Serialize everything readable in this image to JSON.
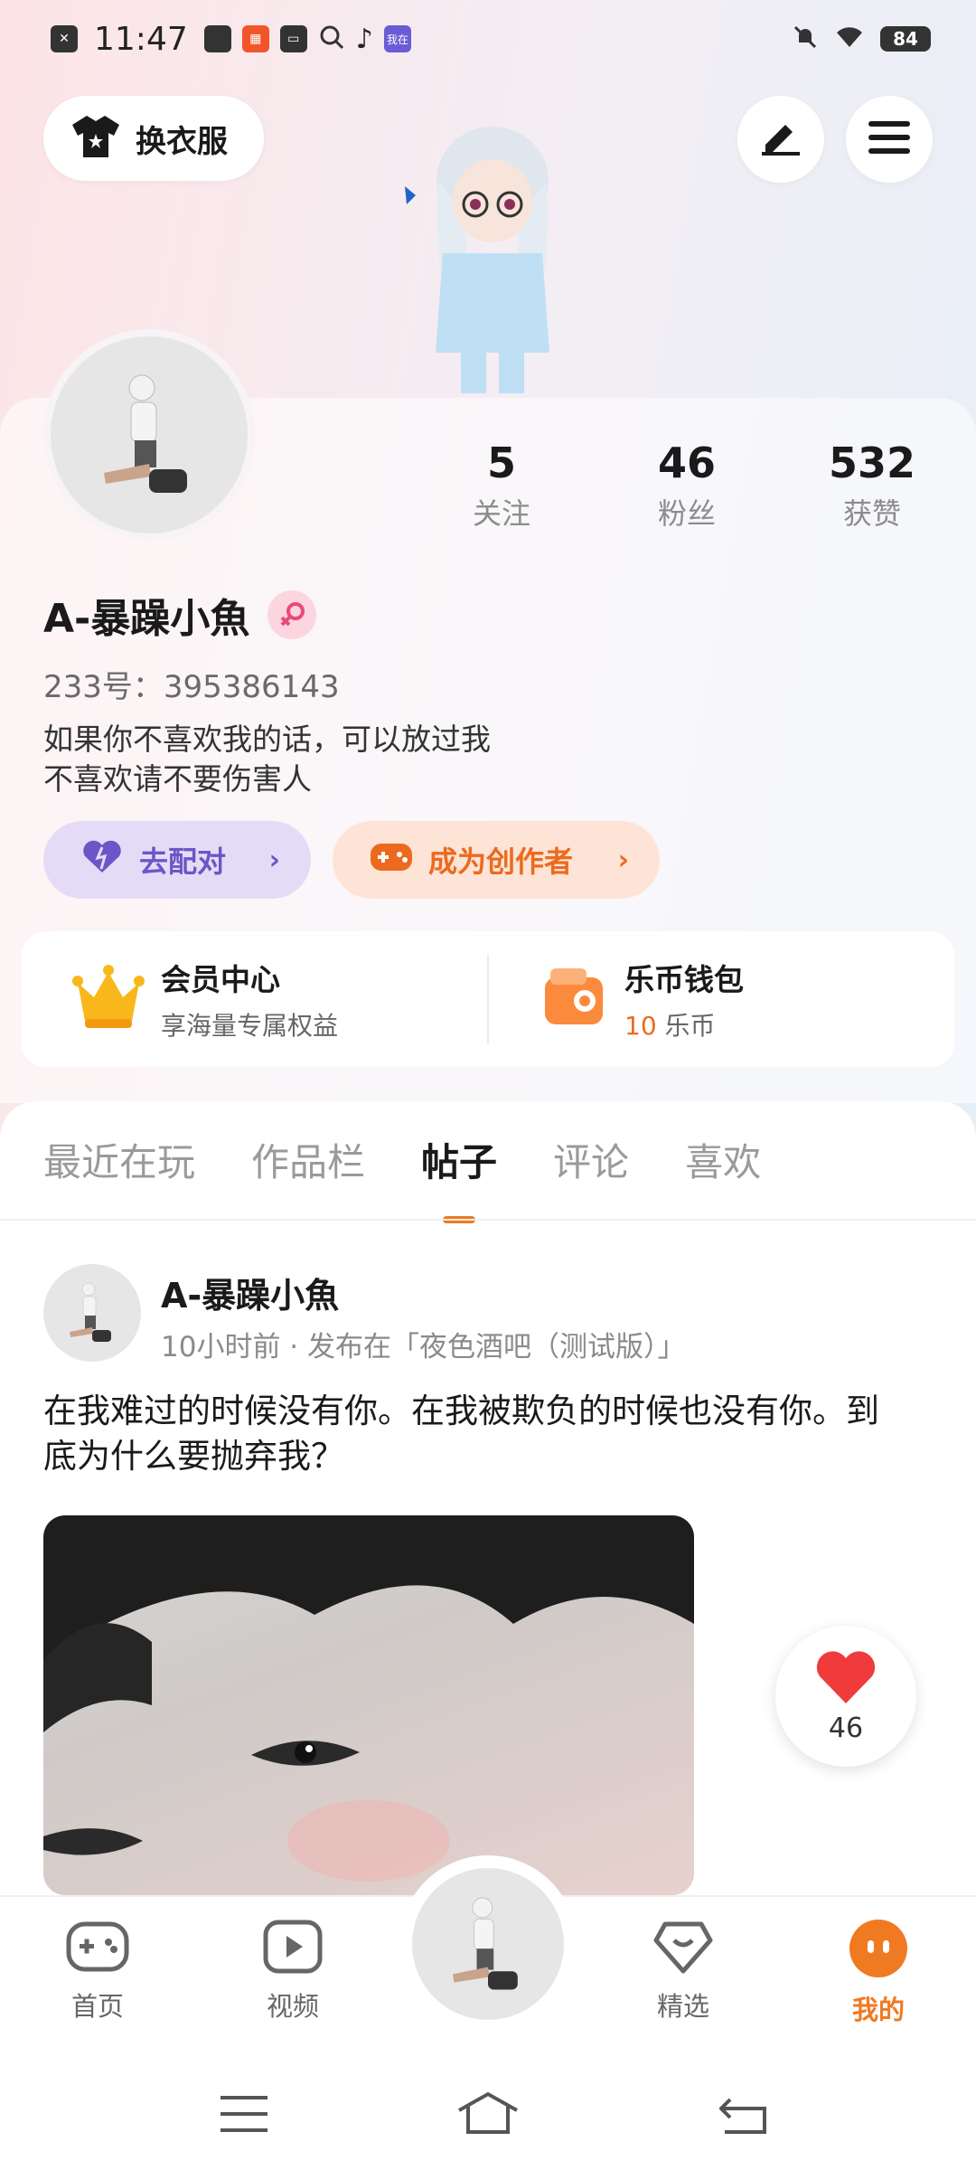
{
  "status_bar": {
    "time": "11:47",
    "battery": "84",
    "app_icon_label": "我在"
  },
  "header": {
    "outfit_label": "换衣服"
  },
  "profile": {
    "stats": [
      {
        "num": "5",
        "label": "关注"
      },
      {
        "num": "46",
        "label": "粉丝"
      },
      {
        "num": "532",
        "label": "获赞"
      }
    ],
    "username": "A-暴躁小魚",
    "user_id": "233号：395386143",
    "bio_line1": "如果你不喜欢我的话，可以放过我",
    "bio_line2": "不喜欢请不要伤害人",
    "match_label": "去配对",
    "creator_label": "成为创作者"
  },
  "member_card": {
    "vip_title": "会员中心",
    "vip_sub": "享海量专属权益",
    "wallet_title": "乐币钱包",
    "coin_count": "10",
    "coin_unit": "乐币"
  },
  "tabs": [
    {
      "label": "最近在玩"
    },
    {
      "label": "作品栏"
    },
    {
      "label": "帖子"
    },
    {
      "label": "评论"
    },
    {
      "label": "喜欢"
    }
  ],
  "active_tab": "帖子",
  "post": {
    "author": "A-暴躁小魚",
    "meta": "10小时前 · 发布在「夜色酒吧（测试版）」",
    "text": "在我难过的时候没有你。在我被欺负的时候也没有你。到底为什么要抛弃我？",
    "like_count": "46"
  },
  "bottom_nav": [
    {
      "label": "首页"
    },
    {
      "label": "视频"
    },
    {
      "label": "精选"
    },
    {
      "label": "我的"
    }
  ],
  "colors": {
    "accent": "#f07a22",
    "match": "#6b56c8",
    "heart": "#ef3b3b"
  }
}
